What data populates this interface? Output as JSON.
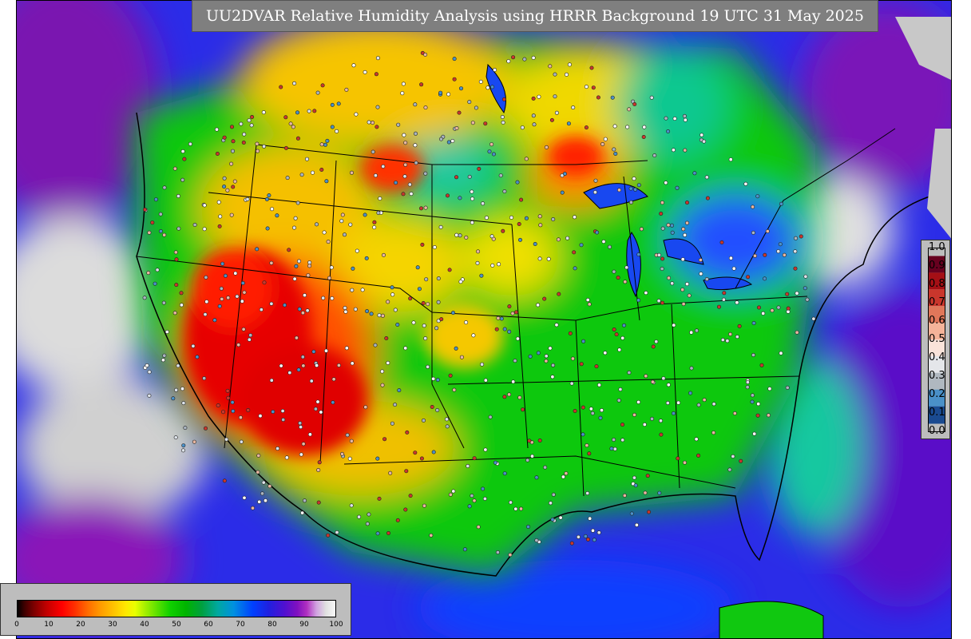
{
  "title": "UU2DVAR Relative Humidity Analysis using HRRR Background 19 UTC 31 May 2025",
  "station_colorbar": {
    "ticks": [
      "1.0",
      "0.9",
      "0.8",
      "0.7",
      "0.6",
      "0.5",
      "0.4",
      "0.3",
      "0.2",
      "0.1",
      "0.0"
    ]
  },
  "rh_colorbar": {
    "ticks": [
      "0",
      "10",
      "20",
      "30",
      "40",
      "50",
      "60",
      "70",
      "80",
      "90",
      "100"
    ]
  },
  "colors": {
    "dry": "#e60000",
    "moderate": "#f5d800",
    "moist": "#10c810",
    "wet": "#0050ff",
    "saturated": "#8a10b8",
    "masked": "#c8c8c8"
  }
}
